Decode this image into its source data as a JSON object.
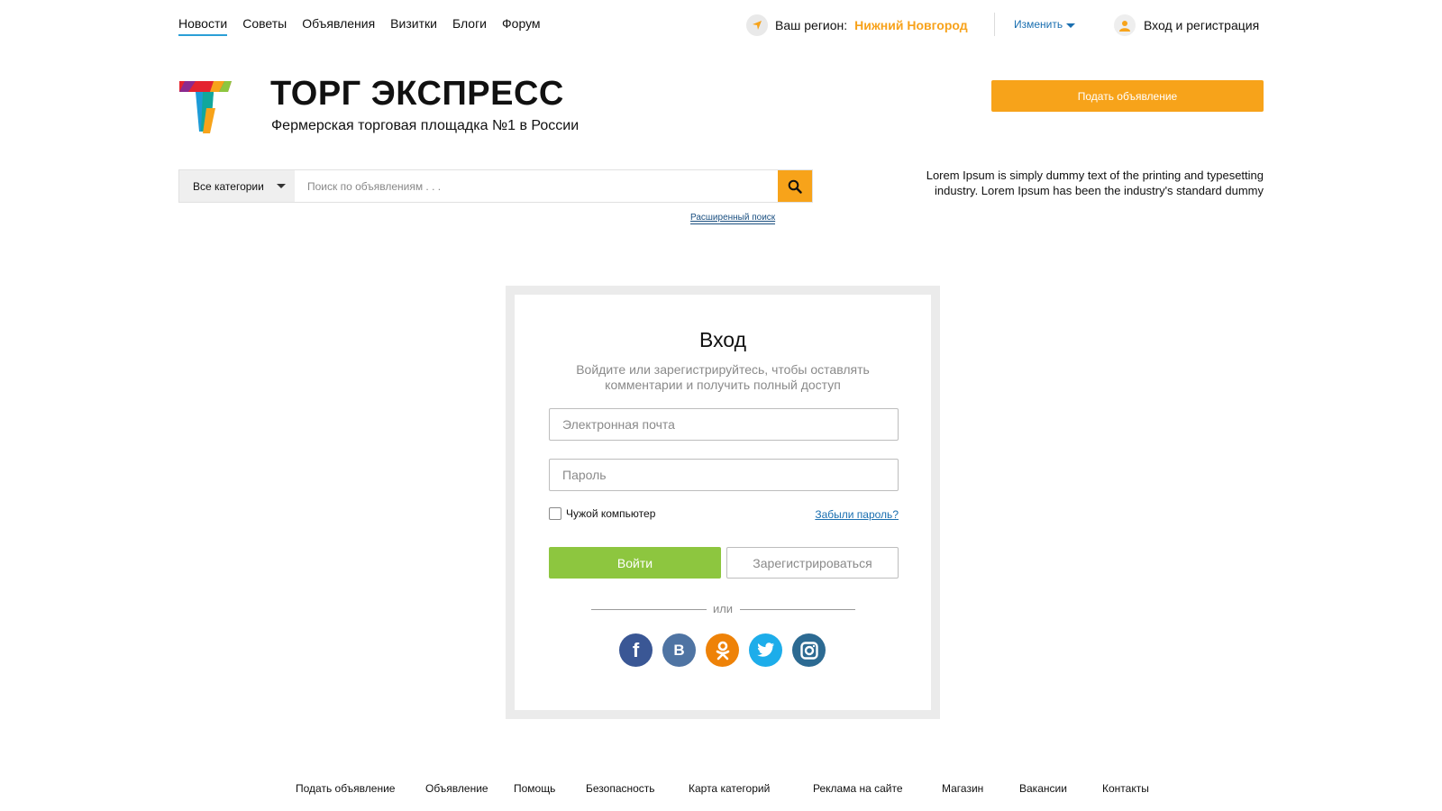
{
  "topnav": {
    "items": [
      "Новости",
      "Советы",
      "Объявления",
      "Визитки",
      "Блоги",
      "Форум"
    ]
  },
  "region": {
    "label": "Ваш регион:",
    "city": "Нижний Новгород",
    "change": "Изменить"
  },
  "auth_link": "Вход и регистрация",
  "header": {
    "brand": "ТОРГ ЭКСПРЕСС",
    "tagline": "Фермерская торговая площадка №1 в России",
    "post_button": "Подать объявление"
  },
  "search": {
    "category": "Все категории",
    "placeholder": "Поиск по объявлениям . . .",
    "advanced": "Расширенный поиск"
  },
  "promo": {
    "line1": "Lorem Ipsum is simply dummy text of the printing and typesetting",
    "line2": "industry. Lorem Ipsum has been the industry's standard dummy"
  },
  "login": {
    "title": "Вход",
    "subtitle_line1": "Войдите или зарегистрируйтесь, чтобы оставлять",
    "subtitle_line2": "комментарии и получить полный доступ",
    "email_placeholder": "Электронная почта",
    "password_placeholder": "Пароль",
    "remember": "Чужой компьютер",
    "forgot": "Забыли пароль?",
    "login_button": "Войти",
    "register_button": "Зарегистрироваться",
    "or": "или",
    "socials": [
      "facebook",
      "vkontakte",
      "odnoklassniki",
      "twitter",
      "instagram"
    ]
  },
  "footer": {
    "items": [
      "Подать объявление",
      "Объявление",
      "Помощь",
      "Безопасность",
      "Карта категорий",
      "Реклама на сайте",
      "Магазин",
      "Вакансии",
      "Контакты"
    ]
  },
  "colors": {
    "accent": "#f7a31a",
    "link": "#1a6fb0",
    "login_green": "#8dc63f",
    "nav_underline": "#2a9fd6"
  }
}
